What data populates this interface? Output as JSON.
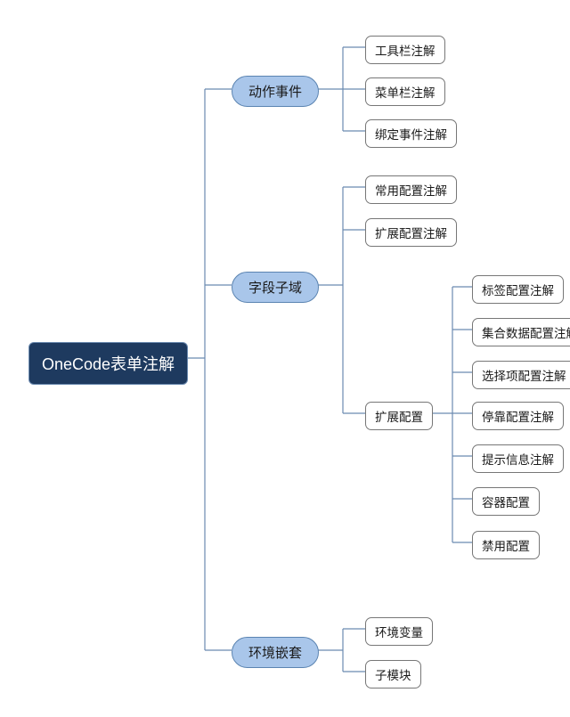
{
  "root": {
    "label": "OneCode表单注解"
  },
  "branches": {
    "action": {
      "label": "动作事件",
      "children": {
        "toolbar": "工具栏注解",
        "menubar": "菜单栏注解",
        "bindevent": "绑定事件注解"
      }
    },
    "field": {
      "label": "字段子域",
      "children": {
        "commonConfig": "常用配置注解",
        "extendConfigA": "扩展配置注解",
        "extendConfig": {
          "label": "扩展配置",
          "children": {
            "labelConfig": "标签配置注解",
            "collectConfig": "集合数据配置注解",
            "selectConfig": "选择项配置注解",
            "dockConfig": "停靠配置注解",
            "hintConfig": "提示信息注解",
            "containerCfg": "容器配置",
            "disableCfg": "禁用配置"
          }
        }
      }
    },
    "env": {
      "label": "环境嵌套",
      "children": {
        "envVar": "环境变量",
        "submodule": "子模块"
      }
    }
  }
}
